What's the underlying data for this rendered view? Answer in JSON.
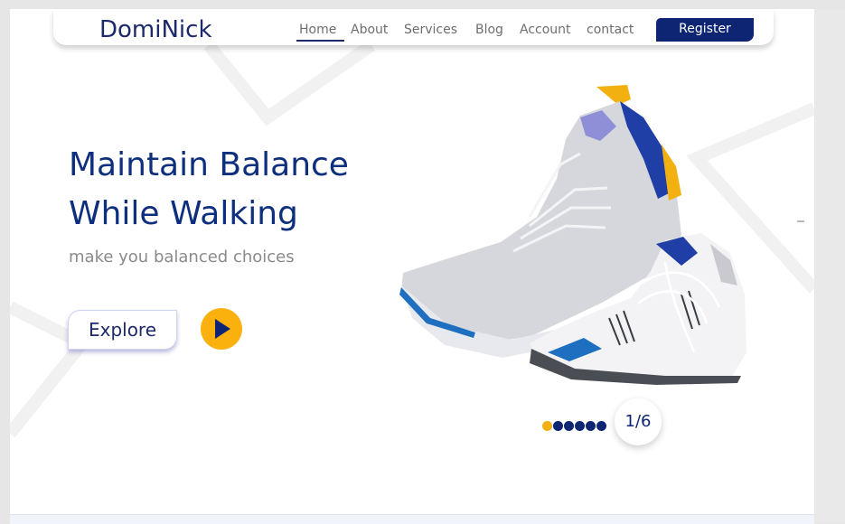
{
  "brand": {
    "logo": "DomiNick"
  },
  "nav": {
    "items": [
      {
        "label": "Home",
        "active": true
      },
      {
        "label": "About",
        "active": false
      },
      {
        "label": "Services",
        "active": false
      },
      {
        "label": "Blog",
        "active": false
      },
      {
        "label": "Account",
        "active": false
      },
      {
        "label": "contact",
        "active": false
      }
    ],
    "register_label": "Register"
  },
  "hero": {
    "headline_line1": "Maintain Balance",
    "headline_line2": "While Walking",
    "subtitle": "make you balanced choices",
    "explore_label": "Explore",
    "play_icon": "play-icon"
  },
  "slider": {
    "dots_total": 6,
    "active_index": 0,
    "counter": "1/6"
  },
  "colors": {
    "primary": "#0d2573",
    "accent": "#f2b111",
    "heading": "#0d2f7e",
    "muted": "#8a8a8a"
  }
}
